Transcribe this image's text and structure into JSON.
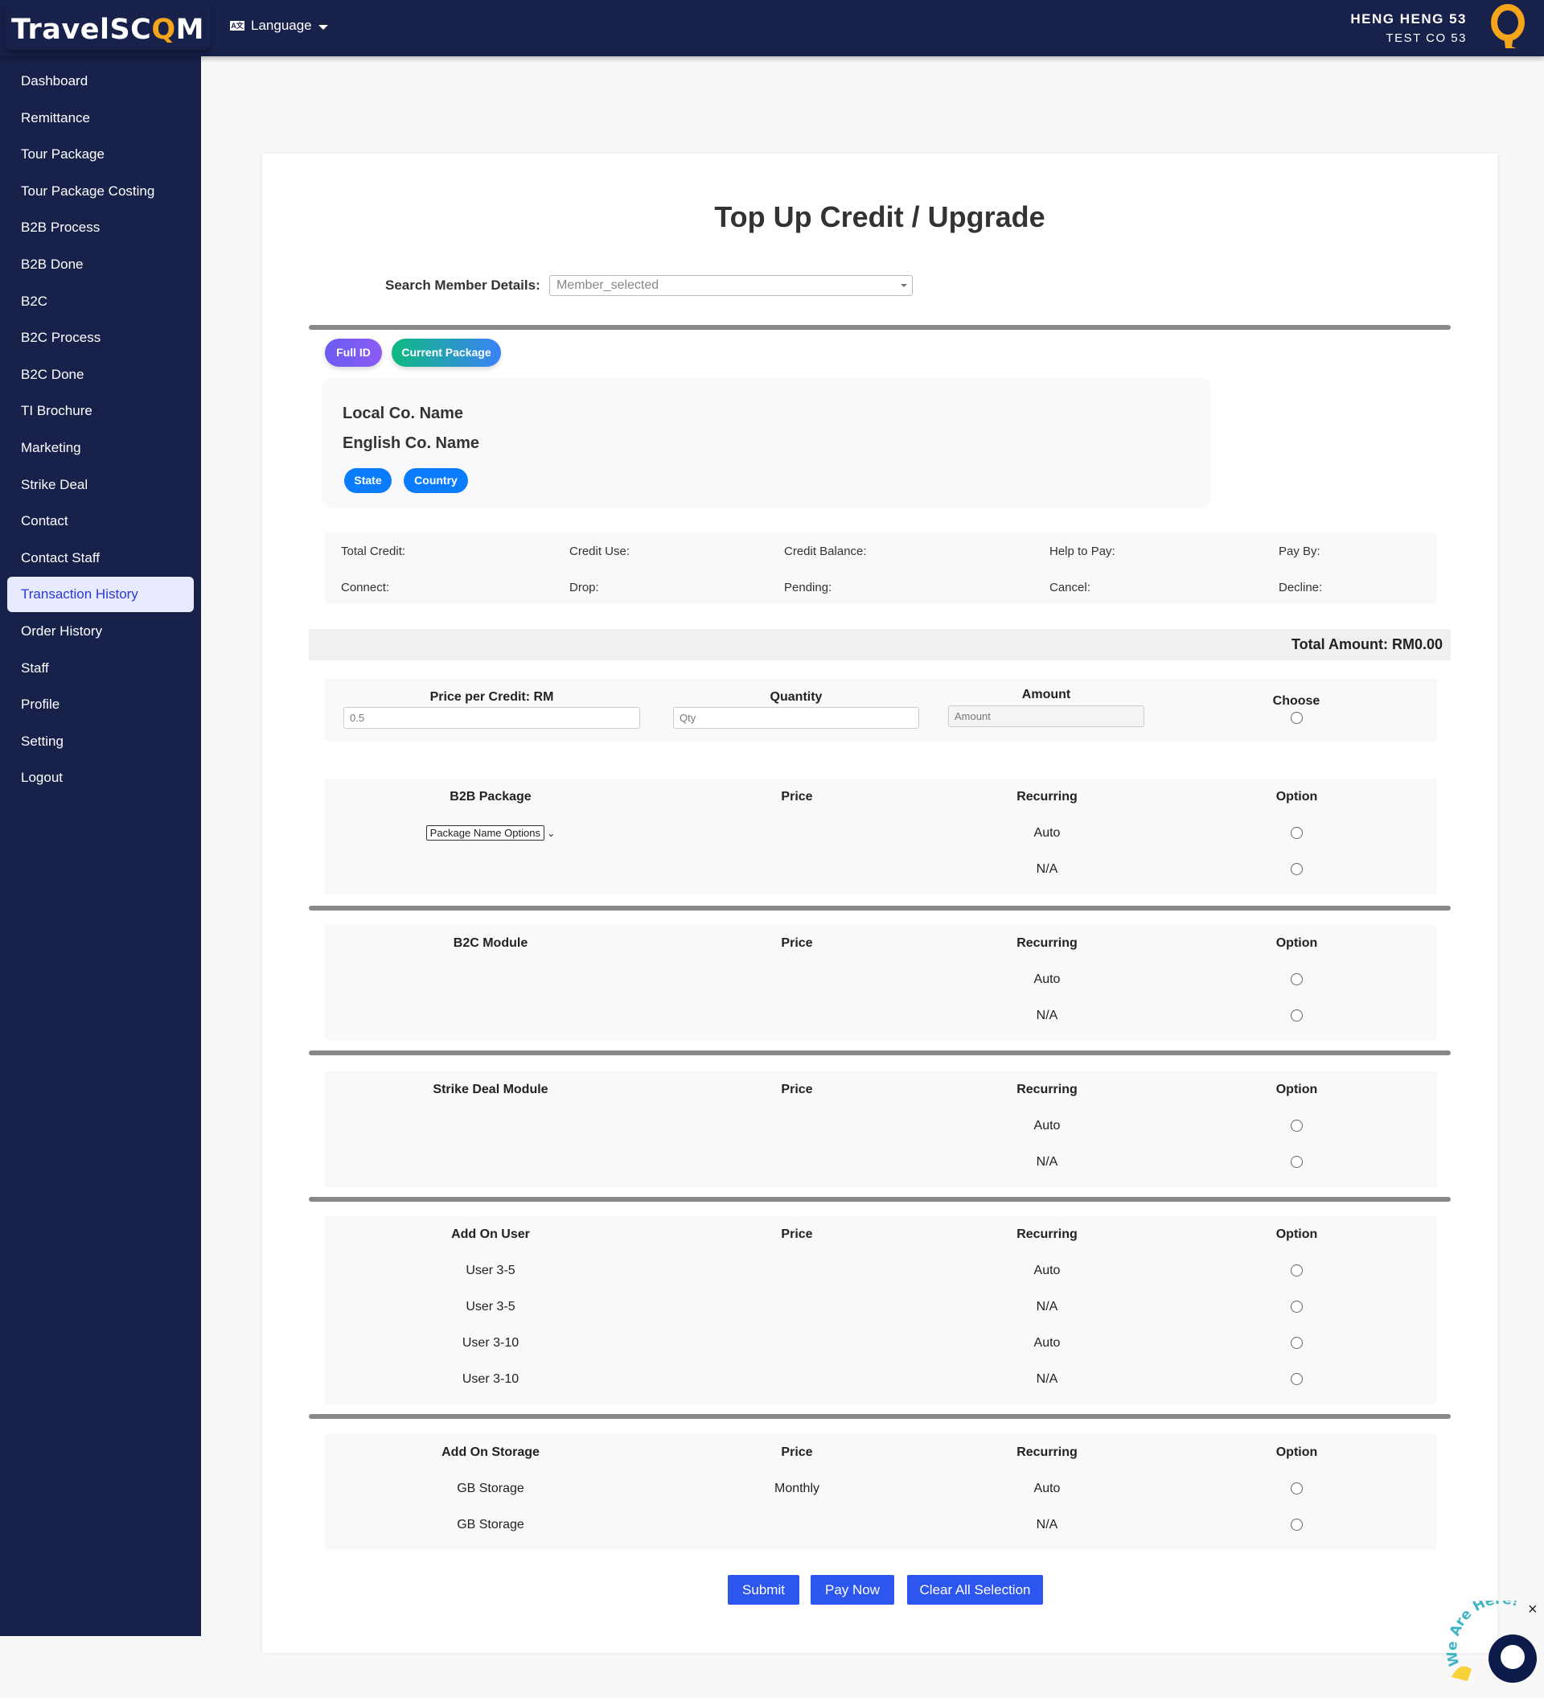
{
  "header": {
    "logo_main": "TravelSC",
    "logo_q": "Q",
    "logo_end": "M",
    "language_icon": "language-icon",
    "language": "Language",
    "user_name": "HENG HENG 53",
    "company": "TEST CO 53",
    "brand_color": "#f4a51c"
  },
  "sidebar": {
    "items": [
      "Dashboard",
      "Remittance",
      "Tour Package",
      "Tour Package Costing",
      "B2B Process",
      "B2B Done",
      "B2C",
      "B2C Process",
      "B2C Done",
      "TI Brochure",
      "Marketing",
      "Strike Deal",
      "Contact",
      "Contact Staff",
      "Transaction History",
      "Order History",
      "Staff",
      "Profile",
      "Setting",
      "Logout"
    ],
    "active_index": 14
  },
  "page": {
    "title": "Top Up Credit / Upgrade",
    "search_label": "Search Member Details:",
    "search_value": "Member_selected"
  },
  "pills": {
    "full_id": "Full ID",
    "current_package": "Current Package"
  },
  "company": {
    "local": "Local Co. Name",
    "english": "English Co. Name",
    "state": "State",
    "country": "Country"
  },
  "stats": {
    "row1": [
      "Total Credit:",
      "Credit Use:",
      "Credit Balance:",
      "Help to Pay:",
      "Pay By:"
    ],
    "row2": [
      "Connect:",
      "Drop:",
      "Pending:",
      "Cancel:",
      "Decline:"
    ]
  },
  "total": "Total Amount: RM0.00",
  "credit": {
    "price_label": "Price per Credit: RM",
    "price_value": "0.5",
    "qty_label": "Quantity",
    "qty_placeholder": "Qty",
    "amount_label": "Amount",
    "amount_placeholder": "Amount",
    "choose_label": "Choose"
  },
  "sections": [
    {
      "headers": [
        "B2B Package",
        "Price",
        "Recurring",
        "Option"
      ],
      "select": "Package Name Options",
      "rows": [
        [
          "",
          "",
          "Auto"
        ],
        [
          "",
          "",
          "N/A"
        ]
      ]
    },
    {
      "headers": [
        "B2C Module",
        "Price",
        "Recurring",
        "Option"
      ],
      "rows": [
        [
          "",
          "",
          "Auto"
        ],
        [
          "",
          "",
          "N/A"
        ]
      ]
    },
    {
      "headers": [
        "Strike Deal Module",
        "Price",
        "Recurring",
        "Option"
      ],
      "rows": [
        [
          "",
          "",
          "Auto"
        ],
        [
          "",
          "",
          "N/A"
        ]
      ]
    },
    {
      "headers": [
        "Add On User",
        "Price",
        "Recurring",
        "Option"
      ],
      "rows": [
        [
          "User 3-5",
          "",
          "Auto"
        ],
        [
          "User 3-5",
          "",
          "N/A"
        ],
        [
          "User 3-10",
          "",
          "Auto"
        ],
        [
          "User 3-10",
          "",
          "N/A"
        ]
      ]
    },
    {
      "headers": [
        "Add On Storage",
        "Price",
        "Recurring",
        "Option"
      ],
      "rows": [
        [
          "GB Storage",
          "Monthly",
          "Auto"
        ],
        [
          "GB Storage",
          "",
          "N/A"
        ]
      ]
    }
  ],
  "buttons": {
    "submit": "Submit",
    "pay_now": "Pay Now",
    "clear": "Clear All Selection"
  },
  "chat": {
    "text": "We Are Here!",
    "close": "×"
  }
}
